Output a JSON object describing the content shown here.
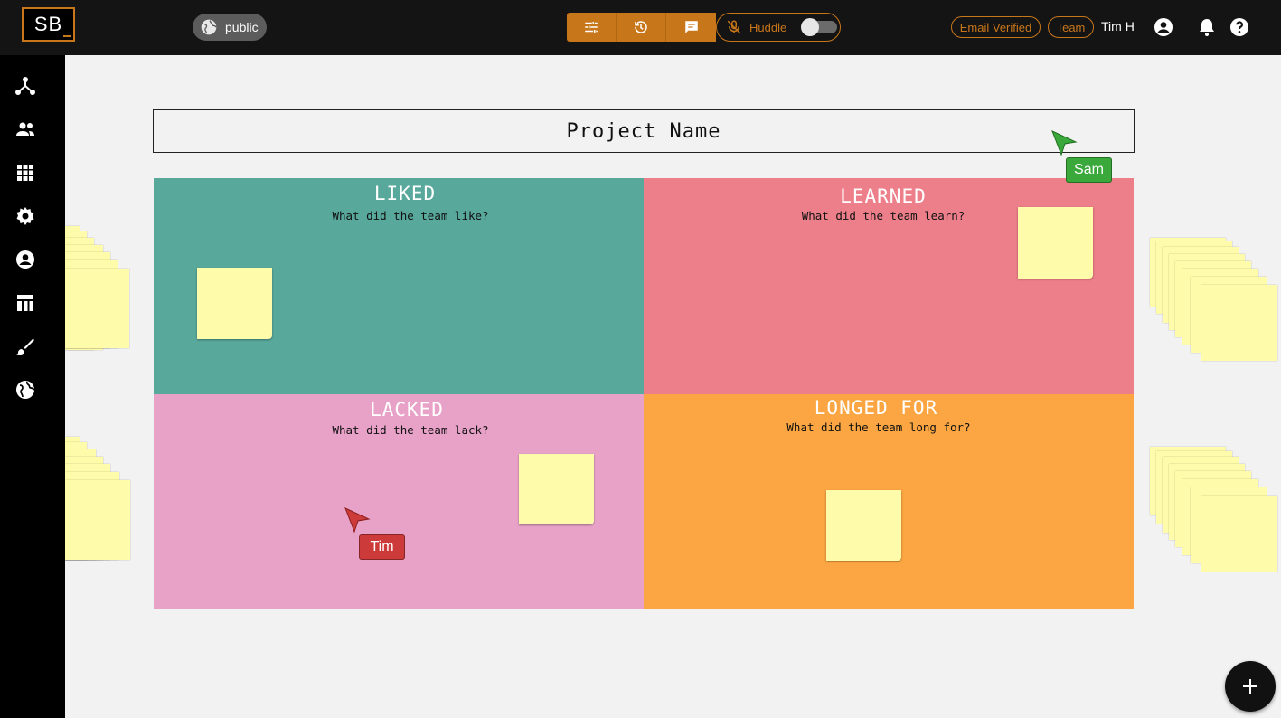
{
  "header": {
    "logo_text": "SB",
    "visibility_label": "public",
    "huddle_label": "Huddle",
    "huddle_enabled": false,
    "chips": [
      "Email Verified",
      "Team"
    ],
    "user_name": "Tim H"
  },
  "toolbar": {
    "icons": [
      "sliders-icon",
      "history-icon",
      "chat-icon"
    ]
  },
  "sidebar": {
    "items": [
      "hierarchy-icon",
      "people-icon",
      "grid-icon",
      "gear-icon",
      "account-icon",
      "table-icon",
      "brush-icon",
      "globe-icon"
    ]
  },
  "board": {
    "project_name": "Project Name",
    "quadrants": [
      {
        "title": "LIKED",
        "subtitle": "What did the team like?",
        "color": "#58a89c"
      },
      {
        "title": "LEARNED",
        "subtitle": "What did the team learn?",
        "color": "#ed7f8a"
      },
      {
        "title": "LACKED",
        "subtitle": "What did the team lack?",
        "color": "#e8a2c8"
      },
      {
        "title": "LONGED FOR",
        "subtitle": "What did the team long for?",
        "color": "#fba642"
      }
    ],
    "note_color": "#fefcaa"
  },
  "cursors": [
    {
      "name": "Sam",
      "color": "#3aa83a"
    },
    {
      "name": "Tim",
      "color": "#cc3a3a"
    }
  ],
  "colors": {
    "accent": "#c8761a",
    "topbar": "#141414",
    "canvas": "#f2f2f2"
  }
}
